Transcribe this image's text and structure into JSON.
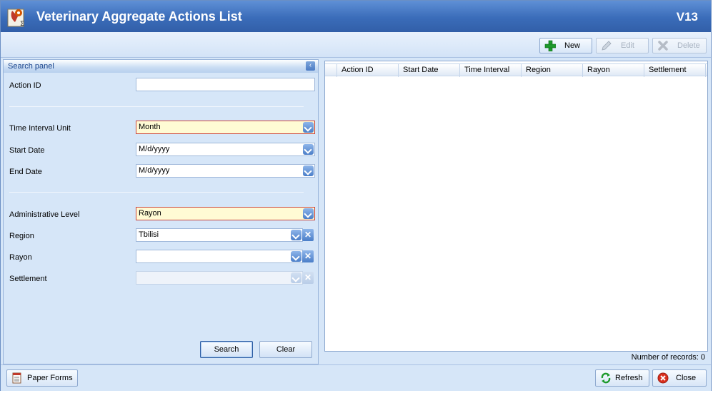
{
  "window": {
    "title": "Veterinary Aggregate Actions List",
    "version": "V13"
  },
  "toolbar": {
    "new_label": "New",
    "edit_label": "Edit",
    "delete_label": "Delete"
  },
  "search_panel": {
    "title": "Search panel",
    "fields": {
      "action_id": {
        "label": "Action ID",
        "value": ""
      },
      "time_interval_unit": {
        "label": "Time Interval Unit",
        "value": "Month"
      },
      "start_date": {
        "label": "Start Date",
        "value": "M/d/yyyy"
      },
      "end_date": {
        "label": "End Date",
        "value": "M/d/yyyy"
      },
      "administrative_level": {
        "label": "Administrative Level",
        "value": "Rayon"
      },
      "region": {
        "label": "Region",
        "value": "Tbilisi"
      },
      "rayon": {
        "label": "Rayon",
        "value": ""
      },
      "settlement": {
        "label": "Settlement",
        "value": ""
      }
    },
    "search_label": "Search",
    "clear_label": "Clear"
  },
  "grid": {
    "columns": [
      "Action ID",
      "Start Date",
      "Time Interval",
      "Region",
      "Rayon",
      "Settlement"
    ],
    "records_text": "Number of records: 0"
  },
  "footer": {
    "paper_forms_label": "Paper Forms",
    "refresh_label": "Refresh",
    "close_label": "Close"
  },
  "colors": {
    "title_bar": "#3a6cb9",
    "panel_bg": "#d6e6f8",
    "required_field": "#fffbd4",
    "required_border": "#c9433e"
  },
  "icons": {
    "app": "veterinary-app-icon",
    "new": "plus-icon",
    "edit": "pencil-icon",
    "delete": "x-icon",
    "refresh": "refresh-icon",
    "close": "close-icon",
    "paper_forms": "document-icon"
  }
}
